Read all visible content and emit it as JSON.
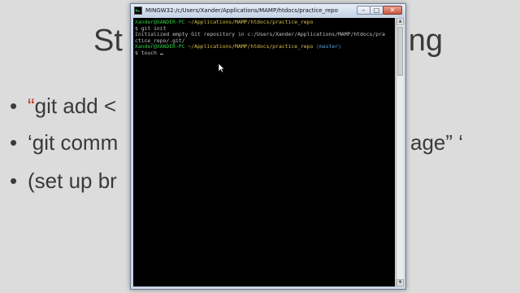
{
  "slide": {
    "title_left": "St",
    "title_right": "ng",
    "bullets": [
      {
        "quote": "“",
        "text": "git add <",
        "right": ""
      },
      {
        "quote": "",
        "text": "‘git comm",
        "right": "age” ‘"
      },
      {
        "quote": "",
        "text": "(set up br",
        "right": ""
      }
    ],
    "bullet_glyph": "•"
  },
  "window": {
    "title": "MINGW32:/c/Users/Xander/Applications/MAMP/htdocs/practice_repo",
    "minimize": "–",
    "maximize": "□",
    "close": "✕",
    "icon": "terminal-icon"
  },
  "console": {
    "lines": [
      {
        "user": "Xander@XANDER-PC",
        "path": " ~/Applications/MAMP/htdocs/practice_repo",
        "branch": ""
      },
      {
        "text": "$ git init"
      },
      {
        "text": "Initialized empty Git repository in c:/Users/Xander/Applications/MAMP/htdocs/pra"
      },
      {
        "text": "ctice_repo/.git/"
      },
      {
        "text": ""
      },
      {
        "user": "Xander@XANDER-PC",
        "path": " ~/Applications/MAMP/htdocs/practice_repo",
        "branch": " (master)"
      },
      {
        "text": "$ touch "
      }
    ]
  },
  "colors": {
    "prompt_user": "#2ecc40",
    "prompt_path": "#d4c04a",
    "prompt_branch": "#4fa3d1",
    "bullet_quote": "#c0392b"
  }
}
